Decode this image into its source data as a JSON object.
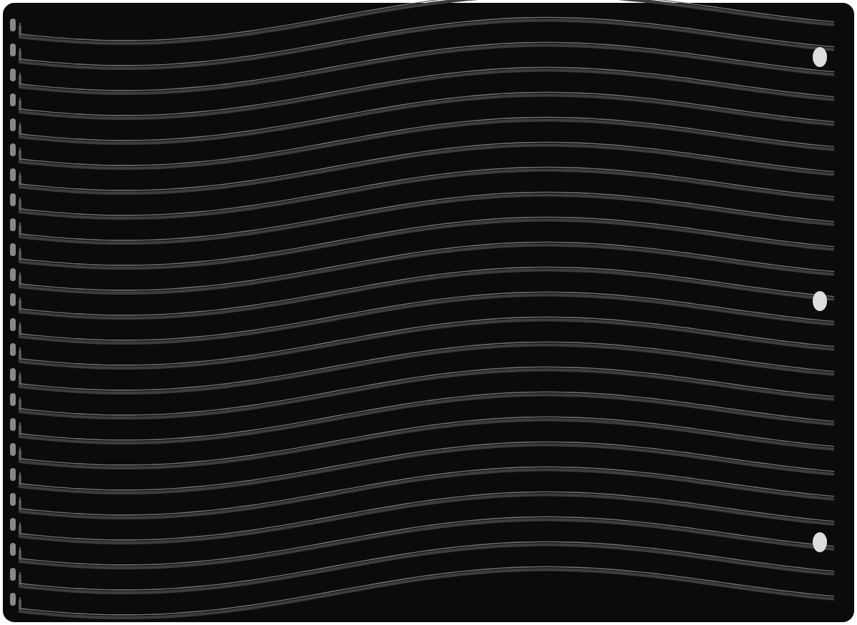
{
  "photo": {
    "kind": "griddle"
  }
}
